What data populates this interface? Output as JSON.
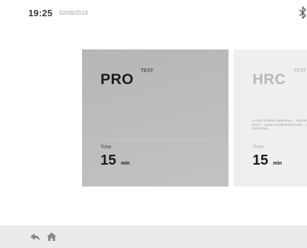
{
  "status_bar": {
    "time": "19:25",
    "date": "02/08/2019",
    "bluetooth_icon": "bluetooth-icon"
  },
  "cards": [
    {
      "title": "PRO",
      "badge": "TEST",
      "description": "",
      "time_label": "Time",
      "time_value": "15",
      "time_unit": "min",
      "selected": true
    },
    {
      "title": "HRC",
      "badge": "TEST",
      "description": "In order to better experience ... recommend you to check ... equip a wireless heart rate ... equip a wireless chest strap ...",
      "time_label": "Time",
      "time_value": "15",
      "time_unit": "min",
      "selected": false
    }
  ],
  "bottom_bar": {
    "back_icon": "back-arrow-icon",
    "home_icon": "home-icon"
  },
  "colors": {
    "selected_card": "#bcbcbc",
    "unselected_card": "#efefef",
    "bottom_bar": "#ebebeb"
  }
}
